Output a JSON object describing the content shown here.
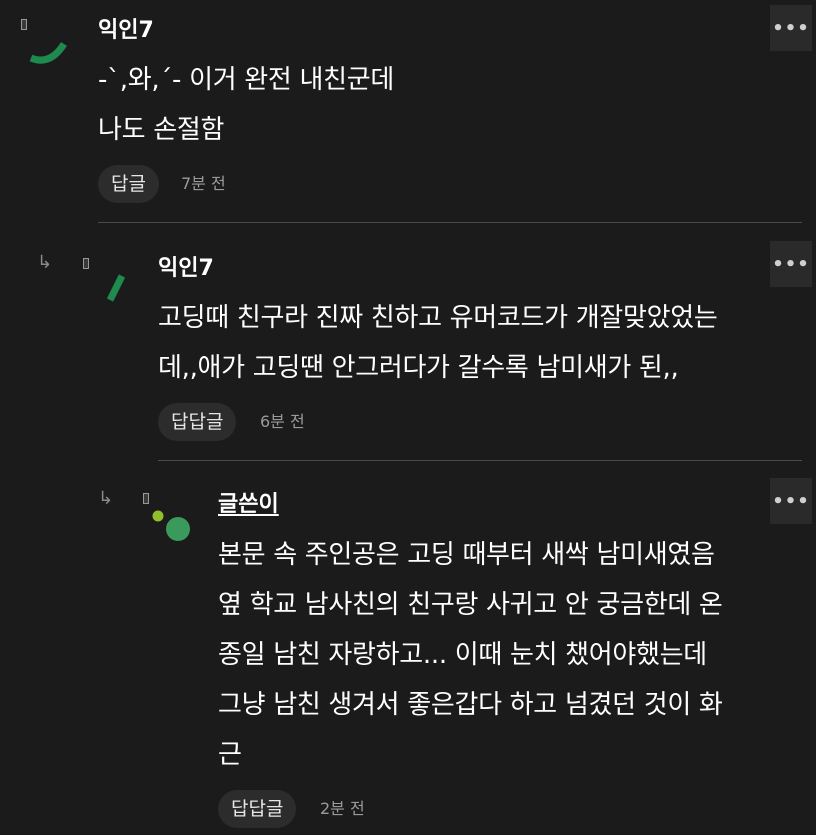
{
  "comments": [
    {
      "author": "익인7",
      "lines": [
        "-`,와,´- 이거 완전 내친군데",
        "나도 손절함"
      ],
      "reply_label": "답글",
      "time": "7분 전",
      "more_label": "•••"
    },
    {
      "author": "익인7",
      "lines": [
        "고딩때 친구라 진짜 친하고 유머코드가 개잘맞았었는",
        "데,,애가 고딩땐 안그러다가 갈수록 남미새가 된,,"
      ],
      "reply_label": "답답글",
      "time": "6분 전",
      "more_label": "•••"
    },
    {
      "author": "글쓴이",
      "lines": [
        "본문 속 주인공은 고딩 때부터 새싹 남미새였음",
        "옆 학교 남사친의 친구랑 사귀고 안 궁금한데 온",
        "종일 남친 자랑하고... 이때 눈치 챘어야했는데",
        "그냥 남친 생겨서 좋은갑다 하고 넘겼던 것이 화",
        "근"
      ],
      "reply_label": "답답글",
      "time": "2분 전",
      "more_label": "•••"
    }
  ],
  "reply_arrow_glyph": "↳",
  "colors": {
    "background": "#1b1b1b",
    "avatar_green": "#1e8a4e",
    "avatar_lime": "#8fbf2a",
    "avatar_green_dot": "#3a9a5c"
  },
  "icons": [
    "reply-arrow-icon",
    "more-icon",
    "avatar-icon"
  ]
}
